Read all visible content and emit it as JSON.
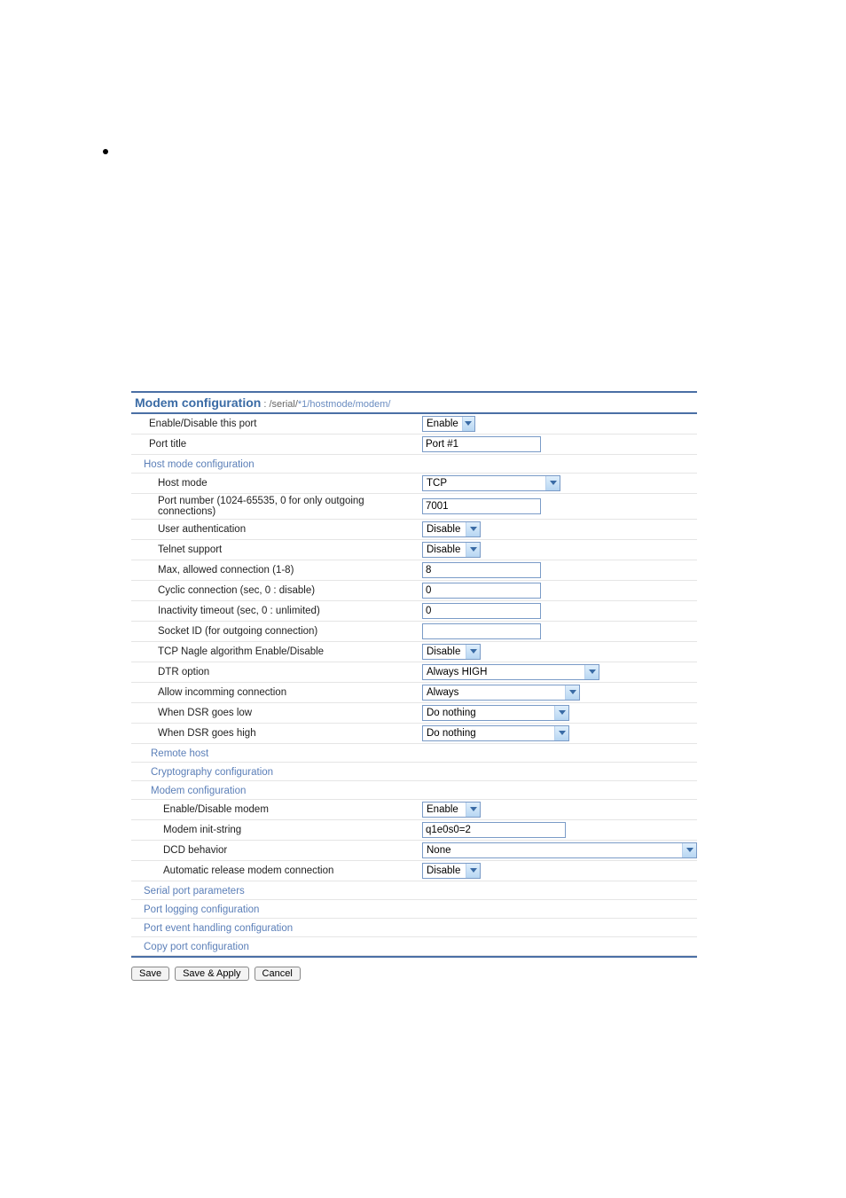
{
  "title": {
    "main": "Modem configuration",
    "sep": " : ",
    "bc": [
      "/serial/",
      "*1/",
      "hostmode/",
      "modem/"
    ]
  },
  "sections": {
    "hostmode": "Host mode configuration",
    "remotehost": "Remote host",
    "crypto": "Cryptography configuration",
    "modem": "Modem configuration",
    "serialparams": "Serial port parameters",
    "portlogging": "Port logging configuration",
    "portevent": "Port event handling configuration",
    "copyport": "Copy port configuration"
  },
  "fields": {
    "enable_port": {
      "label": "Enable/Disable this port",
      "value": "Enable"
    },
    "port_title": {
      "label": "Port title",
      "value": "Port #1"
    },
    "host_mode": {
      "label": "Host mode",
      "value": "TCP"
    },
    "port_number": {
      "label": "Port number (1024-65535, 0 for only outgoing connections)",
      "value": "7001"
    },
    "user_auth": {
      "label": "User authentication",
      "value": "Disable"
    },
    "telnet": {
      "label": "Telnet support",
      "value": "Disable"
    },
    "max_conn": {
      "label": "Max, allowed connection (1-8)",
      "value": "8"
    },
    "cyclic": {
      "label": "Cyclic connection (sec, 0 : disable)",
      "value": "0"
    },
    "inactivity": {
      "label": "Inactivity timeout (sec, 0 : unlimited)",
      "value": "0"
    },
    "socket_id": {
      "label": "Socket ID (for outgoing connection)",
      "value": ""
    },
    "nagle": {
      "label": "TCP Nagle algorithm Enable/Disable",
      "value": "Disable"
    },
    "dtr": {
      "label": "DTR option",
      "value": "Always HIGH"
    },
    "allow_in": {
      "label": "Allow incomming connection",
      "value": "Always"
    },
    "dsr_low": {
      "label": "When DSR goes low",
      "value": "Do nothing"
    },
    "dsr_high": {
      "label": "When DSR goes high",
      "value": "Do nothing"
    },
    "en_modem": {
      "label": "Enable/Disable modem",
      "value": "Enable"
    },
    "init_string": {
      "label": "Modem init-string",
      "value": "q1e0s0=2"
    },
    "dcd": {
      "label": "DCD behavior",
      "value": "None"
    },
    "auto_release": {
      "label": "Automatic release modem connection",
      "value": "Disable"
    }
  },
  "buttons": {
    "save": "Save",
    "save_apply": "Save & Apply",
    "cancel": "Cancel"
  }
}
